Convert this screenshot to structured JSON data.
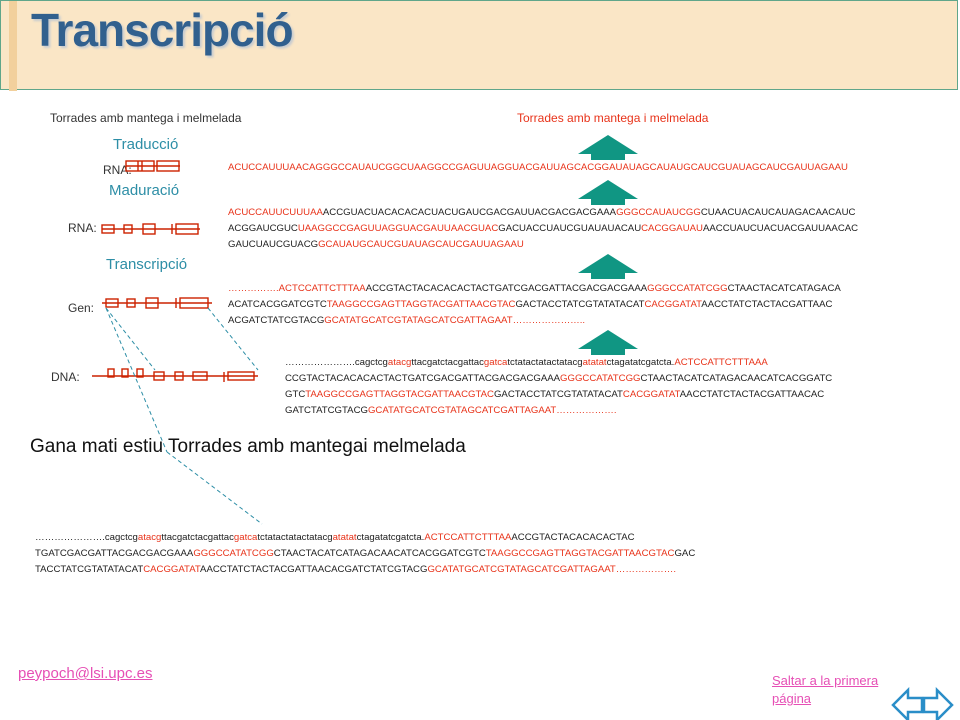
{
  "title": "Transcripció",
  "phrase_left": "Torrades amb mantega i melmelada",
  "phrase_right": "Torrades amb mantega i melmelada",
  "steps": {
    "traduccio": "Traducció",
    "maduracio": "Maduració",
    "transcripcio": "Transcripció"
  },
  "labels": {
    "rna_top": "RNA:",
    "rna_mid": "RNA:",
    "gen": "Gen:",
    "dna": "DNA:"
  },
  "sequences": {
    "mrna_line": [
      {
        "t": "ACUCCAUUUAACAGGGCCAUAUCGGCUAAGGCCGAGUUAGGUACGAUUAGCACGGAUAUAGCAUAUGCAUCGUAUAGCAUCGAUUAGAAU",
        "red": true
      }
    ],
    "prerna_lines": [
      [
        {
          "t": "ACUCCAUUCUUUAA",
          "red": true
        },
        {
          "t": "ACCGUACUACACACACUACUGAUCGACGAUUACGACGACGAAA",
          "red": false
        },
        {
          "t": "GGGCCAUAUCGG",
          "red": true
        },
        {
          "t": "CUAACUACAUCAUAGACAACAUC",
          "red": false
        }
      ],
      [
        {
          "t": "ACGGAUCGUC",
          "red": false
        },
        {
          "t": "UAAGGCCGAGUUAGGUACGAUUAACGUAC",
          "red": true
        },
        {
          "t": "GACUACCUAUCGUAUAUACAU",
          "red": false
        },
        {
          "t": "CACGGAUAU",
          "red": true
        },
        {
          "t": "AACCUAUCUACUACGAUUAACAC",
          "red": false
        }
      ],
      [
        {
          "t": "GAUCUAUCGUACG",
          "red": false
        },
        {
          "t": "GCAUAUGCAUCGUAUAGCAUCGAUUAGAAU",
          "red": true
        }
      ]
    ],
    "gene_lines": [
      [
        {
          "t": "……………",
          "red": true
        },
        {
          "t": ".ACTCCATTCTTTAA",
          "red": true
        },
        {
          "t": "ACCGTACTACACACACTACTGATCGACGATTACGACGACGAAA",
          "red": false
        },
        {
          "t": "GGGCCATATCGG",
          "red": true
        },
        {
          "t": "CTAACTACATCATAGACA",
          "red": false
        }
      ],
      [
        {
          "t": "ACATCACGGATCGTC",
          "red": false
        },
        {
          "t": "TAAGGCCGAGTTAGGTACGATTAACGTAC",
          "red": true
        },
        {
          "t": "GACTACCTATCGTATATACAT",
          "red": false
        },
        {
          "t": "CACGGATAT",
          "red": true
        },
        {
          "t": "AACCTATCTACTACGATTAAC",
          "red": false
        }
      ],
      [
        {
          "t": "ACGATCTATCGTACG",
          "red": false
        },
        {
          "t": "GCATATGCATCGTATAGCATCGATTAGAAT",
          "red": true
        },
        {
          "t": "…………………..",
          "red": true
        }
      ]
    ],
    "dna_lines": [
      [
        {
          "t": "………………….cagctcg",
          "red": false
        },
        {
          "t": "atacg",
          "red": true
        },
        {
          "t": "ttacgatctacgattac",
          "red": false
        },
        {
          "t": "gatca",
          "red": true
        },
        {
          "t": "tctatactatactatacg",
          "red": false
        },
        {
          "t": "atatat",
          "red": true
        },
        {
          "t": "ctagatatcgatcta.",
          "red": false
        },
        {
          "t": "ACTCCATTCTTTAAA",
          "red": true
        }
      ],
      [
        {
          "t": "CCGTACTACACACACTACTGATCGACGATTACGACGACGAAA",
          "red": false
        },
        {
          "t": "GGGCCATATCGG",
          "red": true
        },
        {
          "t": "CTAACTACATCATAGACAACATCACGGATC",
          "red": false
        }
      ],
      [
        {
          "t": "GTC",
          "red": false
        },
        {
          "t": "TAAGGCCGAGTTAGGTACGATTAACGTAC",
          "red": true
        },
        {
          "t": "GACTACCTATCGTATATACAT",
          "red": false
        },
        {
          "t": "CACGGATAT",
          "red": true
        },
        {
          "t": "AACCTATCTACTACGATTAACAC",
          "red": false
        }
      ],
      [
        {
          "t": "GATCTATCGTACG",
          "red": false
        },
        {
          "t": "GCATATGCATCGTATAGCATCGATTAGAAT",
          "red": true
        },
        {
          "t": "……………….",
          "red": true
        }
      ]
    ],
    "bottom_lines": [
      [
        {
          "t": "………………….cagctcg",
          "red": false
        },
        {
          "t": "atacg",
          "red": true
        },
        {
          "t": "ttacgatctacgattac",
          "red": false
        },
        {
          "t": "gatca",
          "red": true
        },
        {
          "t": "tctatactatactatacg",
          "red": false
        },
        {
          "t": "atatat",
          "red": true
        },
        {
          "t": "ctagatatcgatcta.",
          "red": false
        },
        {
          "t": "ACTCCATTCTTTAA",
          "red": true
        },
        {
          "t": "ACCGTACTACACACACTAC",
          "red": false
        }
      ],
      [
        {
          "t": "TGATCGACGATTACGACGACGAAA",
          "red": false
        },
        {
          "t": "GGGCCATATCGG",
          "red": true
        },
        {
          "t": "CTAACTACATCATAGACAACATCACGGATCGTC",
          "red": false
        },
        {
          "t": "TAAGGCCGAGTTAGGTACGATTAACGTAC",
          "red": true
        },
        {
          "t": "GAC",
          "red": false
        }
      ],
      [
        {
          "t": "TACCTATCGTATATACAT",
          "red": false
        },
        {
          "t": "CACGGATAT",
          "red": true
        },
        {
          "t": "AACCTATCTACTACGATTAACACGATCTATCGTACG",
          "red": false
        },
        {
          "t": "GCATATGCATCGTATAGCATCGATTAGAAT",
          "red": true
        },
        {
          "t": "……………….",
          "red": true
        }
      ]
    ]
  },
  "phrase_big": "Gana mati estiu Torrades amb mantegai melmelada",
  "footer": {
    "email": "peypoch@lsi.upc.es",
    "back_link": "Saltar a la primera página"
  },
  "colors": {
    "title": "#31608e",
    "accent_red": "#e8331a",
    "teal": "#2d8ea6",
    "arrow": "#109683",
    "link": "#e64fb5"
  }
}
